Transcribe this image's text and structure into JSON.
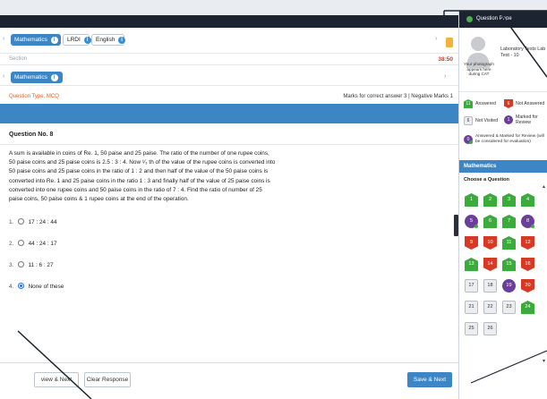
{
  "header": {
    "subject_tabs": [
      {
        "label": "Mathematics",
        "active": true
      },
      {
        "label": "LRDI",
        "active": false
      },
      {
        "label": "English",
        "active": false
      }
    ],
    "info_glyph": "i",
    "section_label": "Section",
    "timer": "38:50"
  },
  "section_tab": {
    "label": "Mathematics"
  },
  "question_meta": {
    "type_label": "Question Type: MCQ",
    "marks_label": "Marks for correct answer 3 | Negative Marks 1"
  },
  "question": {
    "number_label": "Question No. 8",
    "lines": [
      "A sum is available in coins of Re. 1, 50 paise and 25 paise. The ratio of the number of one rupee coins,",
      "50 paise coins and 25 paise coins is 2.5 : 3 : 4. Now ¹⁄₃ th of the value of the rupee coins is converted into",
      "50 paise coins and 25 paise coins in the ratio of 1 : 2 and then half of the value of the 50 paise coins is",
      "converted into Re. 1 and 25 paise coins in the ratio 1 : 3 and finally half of the value of 25 paise coins is",
      "converted into one rupee coins and 50 paise coins in the ratio of 7 : 4. Find the ratio of number of 25",
      "paise coins, 50 paise coins & 1 rupee coins at the end of the operation."
    ],
    "options": [
      {
        "num": "1.",
        "text": "17 : 24 : 44",
        "selected": false
      },
      {
        "num": "2.",
        "text": "44 : 24 : 17",
        "selected": false
      },
      {
        "num": "3.",
        "text": "11 : 6 : 27",
        "selected": false
      },
      {
        "num": "4.",
        "text": "None of these",
        "selected": true
      }
    ]
  },
  "buttons": {
    "review_next": "view & Next",
    "clear": "Clear Response",
    "save_next": "Save & Next"
  },
  "sidebar": {
    "title": "Question Pape",
    "photo_text": "Your photograph appears here during CAT",
    "candidate": "Laboratory Tests Lab Test - 10",
    "legend": {
      "answered_count": "11",
      "answered_label": "Answered",
      "not_answered_count": "6",
      "not_answered_label": "Not Answered",
      "not_visited_count": "6",
      "not_visited_label": "Not Visited",
      "marked_count": "1",
      "marked_label": "Marked for Review",
      "ans_marked_count": "0",
      "ans_marked_label": "Answered & Marked for Review (will be considered for evaluation)"
    },
    "subject": "Mathematics",
    "choose_label": "Choose a Question",
    "palette": [
      {
        "n": "1",
        "s": "ans"
      },
      {
        "n": "2",
        "s": "ans"
      },
      {
        "n": "3",
        "s": "ans"
      },
      {
        "n": "4",
        "s": "ans"
      },
      {
        "n": "5",
        "s": "ansrev"
      },
      {
        "n": "6",
        "s": "ans"
      },
      {
        "n": "7",
        "s": "ans"
      },
      {
        "n": "8",
        "s": "ansrev"
      },
      {
        "n": "9",
        "s": "notans"
      },
      {
        "n": "10",
        "s": "notans"
      },
      {
        "n": "11",
        "s": "ans"
      },
      {
        "n": "12",
        "s": "notans"
      },
      {
        "n": "13",
        "s": "ans"
      },
      {
        "n": "14",
        "s": "notans"
      },
      {
        "n": "15",
        "s": "ans"
      },
      {
        "n": "16",
        "s": "notans"
      },
      {
        "n": "17",
        "s": "nv"
      },
      {
        "n": "18",
        "s": "nv"
      },
      {
        "n": "19",
        "s": "rev"
      },
      {
        "n": "20",
        "s": "notans"
      },
      {
        "n": "21",
        "s": "nv"
      },
      {
        "n": "22",
        "s": "nv"
      },
      {
        "n": "23",
        "s": "nv"
      },
      {
        "n": "24",
        "s": "ans"
      },
      {
        "n": "25",
        "s": "nv"
      },
      {
        "n": "26",
        "s": "nv"
      }
    ]
  },
  "colors": {
    "accent_blue": "#3d86c6",
    "answered_green": "#3bab3b",
    "not_answered_red": "#d73a24",
    "review_purple": "#6a3f9a",
    "timer_red": "#d9351e",
    "dark_bar": "#1d2431"
  },
  "icons": [
    "info-icon",
    "calculator-icon",
    "chevron-left-icon",
    "chevron-right-icon",
    "avatar-silhouette-icon"
  ]
}
